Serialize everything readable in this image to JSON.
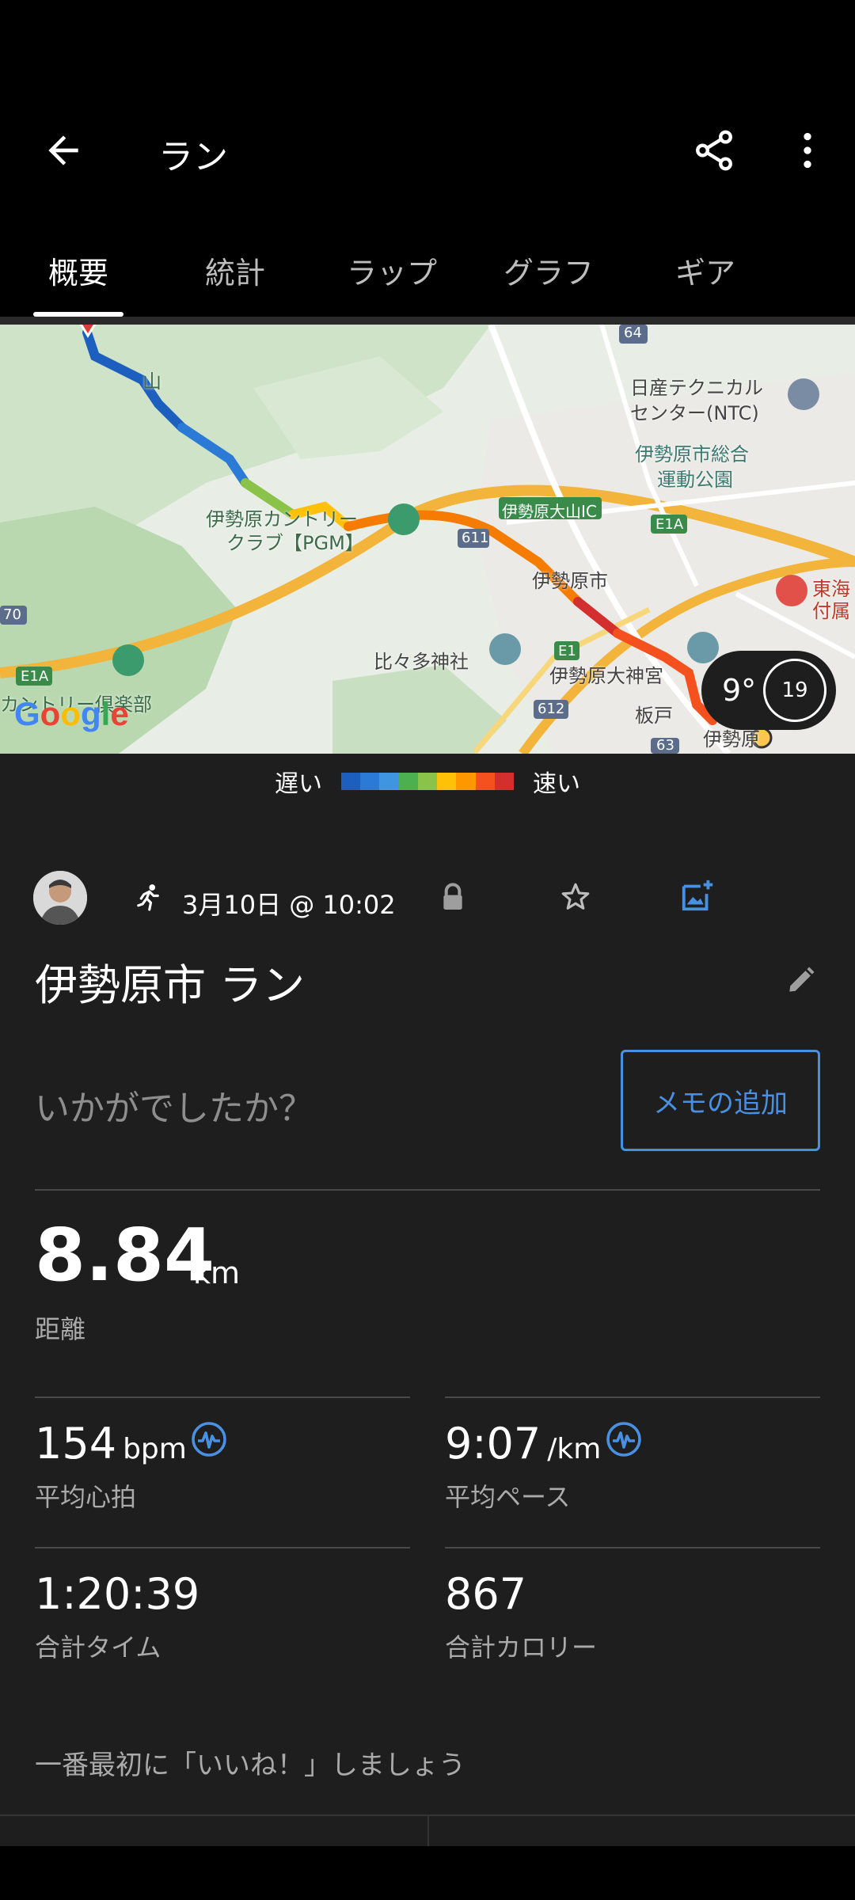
{
  "appbar": {
    "title": "ラン"
  },
  "tabs": [
    {
      "label": "概要",
      "active": true
    },
    {
      "label": "統計",
      "active": false
    },
    {
      "label": "ラップ",
      "active": false
    },
    {
      "label": "グラフ",
      "active": false
    },
    {
      "label": "ギア",
      "active": false
    }
  ],
  "map": {
    "labels": {
      "hill": "山",
      "nissan_1": "日産テクニカル",
      "nissan_2": "センター(NTC)",
      "park_1": "伊勢原市総合",
      "park_2": "運動公園",
      "ic": "伊勢原大山IC",
      "club_1": "伊勢原カントリー",
      "club_2": "クラブ【PGM】",
      "city": "伊勢原市",
      "shrine": "比々多神社",
      "daijingu": "伊勢原大神宮",
      "itado": "板戸",
      "station": "伊勢原",
      "golf_club": "カントリー倶楽部",
      "hospital_1": "東海",
      "hospital_2": "付属",
      "r64": "64",
      "r611": "611",
      "r612": "612",
      "r63": "63",
      "r70": "70",
      "e1a_1": "E1A",
      "e1a_2": "E1A",
      "e1": "E1"
    },
    "google": "Google",
    "weather_temp": "9°",
    "wind": "19"
  },
  "legend": {
    "slow": "遅い",
    "fast": "速い",
    "colors": [
      "#1d5fbf",
      "#2a7ad6",
      "#3f95e0",
      "#4caf50",
      "#8bc34a",
      "#ffc107",
      "#ff9800",
      "#f4511e",
      "#d32f2f"
    ]
  },
  "activity": {
    "date": "3月10日 @ 10:02",
    "title": "伊勢原市 ラン",
    "memo_placeholder": "いかがでしたか？",
    "memo_button": "メモの追加",
    "distance": {
      "value": "8.84",
      "unit": "km",
      "label": "距離"
    },
    "heart_rate": {
      "value": "154",
      "unit": "bpm",
      "label": "平均心拍"
    },
    "pace": {
      "value": "9:07",
      "unit": "/km",
      "label": "平均ペース"
    },
    "time": {
      "value": "1:20:39",
      "label": "合計タイム"
    },
    "calories": {
      "value": "867",
      "label": "合計カロリー"
    },
    "like_prompt": "一番最初に「いいね！」しましょう"
  }
}
